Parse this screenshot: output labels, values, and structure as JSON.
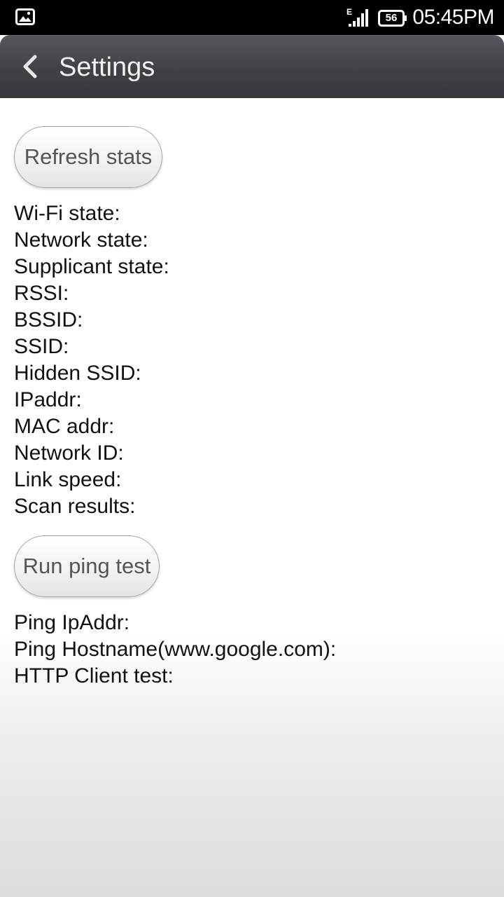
{
  "status_bar": {
    "network_type": "E",
    "battery_level": "56",
    "time": "05:45PM",
    "icons": [
      "gallery-icon",
      "signal-icon",
      "battery-icon"
    ]
  },
  "action_bar": {
    "title": "Settings",
    "back_icon": "chevron-left-icon"
  },
  "buttons": {
    "refresh": "Refresh stats",
    "ping": "Run ping test"
  },
  "stats": [
    "Wi-Fi state:",
    "Network state:",
    "Supplicant state:",
    "RSSI:",
    "BSSID:",
    "SSID:",
    "Hidden SSID:",
    "IPaddr:",
    "MAC addr:",
    "Network ID:",
    "Link speed:",
    "Scan results:"
  ],
  "ping_results": [
    "Ping IpAddr:",
    "Ping Hostname(www.google.com):",
    "HTTP Client test:"
  ],
  "colors": {
    "status_bar_bg": "#000000",
    "action_bar_bg": "#3f4147",
    "text": "#111111",
    "button_text": "#555555"
  }
}
